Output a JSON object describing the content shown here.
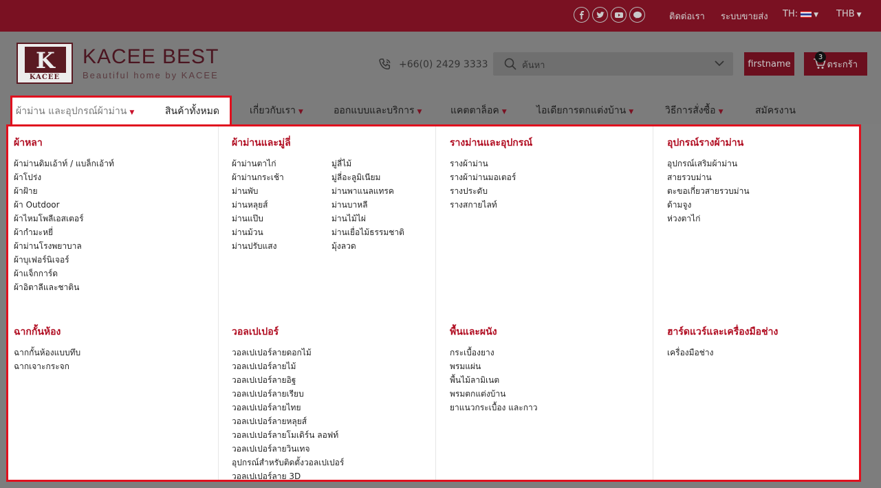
{
  "topbar": {
    "social": [
      {
        "icon": "facebook-icon"
      },
      {
        "icon": "twitter-icon"
      },
      {
        "icon": "youtube-icon"
      },
      {
        "icon": "line-icon"
      }
    ],
    "contact_label": "ติดต่อเรา",
    "reseller_label": "ระบบขายส่ง",
    "language_label": "TH:",
    "currency_label": "THB"
  },
  "header": {
    "logo_text": "KACEE",
    "brand_name": "KACEE BEST",
    "tagline": "Beautiful home by KACEE",
    "phone": "+66(0) 2429 3333",
    "search_placeholder": "ค้นหา",
    "account_label": "firstname",
    "cart_label": "ตระกร้า",
    "cart_count": "3"
  },
  "nav": {
    "active_item": "ผ้าม่าน และอุปกรณ์ผ้าม่าน",
    "all_products": "สินค้าทั้งหมด",
    "items": [
      "เกี่ยวกับเรา",
      "ออกแบบและบริการ",
      "แคตตาล็อค",
      "ไอเดียการตกแต่งบ้าน",
      "วิธีการสั่งซื้อ",
      "สมัครงาน"
    ]
  },
  "menu": {
    "fabric": {
      "title": "ผ้าหลา",
      "items": [
        "ผ้าม่านดิมเอ้าท์ / แบล็กเอ้าท์",
        "ผ้าโปร่ง",
        "ผ้าฝ้าย",
        "ผ้า Outdoor",
        "ผ้าไหมโพลีเอสเตอร์",
        "ผ้ากำมะหยี่",
        "ผ้าม่านโรงพยาบาล",
        "ผ้าบุเฟอร์นิเจอร์",
        "ผ้าแจ็กการ์ด",
        "ผ้าอิตาลีและชาติน"
      ]
    },
    "curtains": {
      "title": "ผ้าม่านและมู่ลี่",
      "items_left": [
        "ผ้าม่านตาไก่",
        "ผ้าม่านกระเช้า",
        "ม่านพับ",
        "ม่านหลุยส์",
        "ม่านแป๊บ",
        "ม่านม้วน",
        "ม่านปรับแสง"
      ],
      "items_right": [
        "มู่ลี่ไม้",
        "มู่ลี่อะลูมิเนียม",
        "ม่านพาแนลแทรค",
        "ม่านบาหลี",
        "ม่านไม้ไผ่",
        "ม่านเยื่อไม้ธรรมชาติ",
        "มุ้งลวด"
      ]
    },
    "rails": {
      "title": "รางม่านและอุปกรณ์",
      "items": [
        "รางผ้าม่าน",
        "รางผ้าม่านมอเตอร์",
        "รางประดับ",
        "รางสกายไลท์"
      ]
    },
    "rail_accessories": {
      "title": "อุปกรณ์รางผ้าม่าน",
      "items": [
        "อุปกรณ์เสริมผ้าม่าน",
        "สายรวบม่าน",
        "ตะขอเกี่ยวสายรวบม่าน",
        "ด้ามจูง",
        "ห่วงตาไก่"
      ]
    },
    "partitions": {
      "title": "ฉากกั้นห้อง",
      "items": [
        "ฉากกั้นห้องแบบทึบ",
        "ฉากเจาะกระจก"
      ]
    },
    "wallpaper": {
      "title": "วอลเปเปอร์",
      "items": [
        "วอลเปเปอร์ลายดอกไม้",
        "วอลเปเปอร์ลายไม้",
        "วอลเปเปอร์ลายอิฐ",
        "วอลเปเปอร์ลายเรียบ",
        "วอลเปเปอร์ลายไทย",
        "วอลเปเปอร์ลายหลุยส์",
        "วอลเปเปอร์ลายโมเดิร์น ลอฟท์",
        "วอลเปเปอร์ลายวินเทจ",
        "อุปกรณ์สำหรับติดตั้งวอลเปเปอร์",
        "วอลเปเปอร์ลาย 3D"
      ]
    },
    "flooring": {
      "title": "พื้นและผนัง",
      "items": [
        "กระเบื้องยาง",
        "พรมแผ่น",
        "พื้นไม้ลามิเนต",
        "พรมตกแต่งบ้าน",
        "ยาแนวกระเบื้อง และกาว"
      ]
    },
    "hardware": {
      "title": "ฮาร์ดแวร์และเครื่องมือช่าง",
      "items": [
        "เครื่องมือช่าง"
      ]
    }
  },
  "colors": {
    "topbar": "#7a1122",
    "accent": "#b10f23",
    "highlight_border": "#e0101e",
    "overlay_gray": "#7c7c7c"
  }
}
